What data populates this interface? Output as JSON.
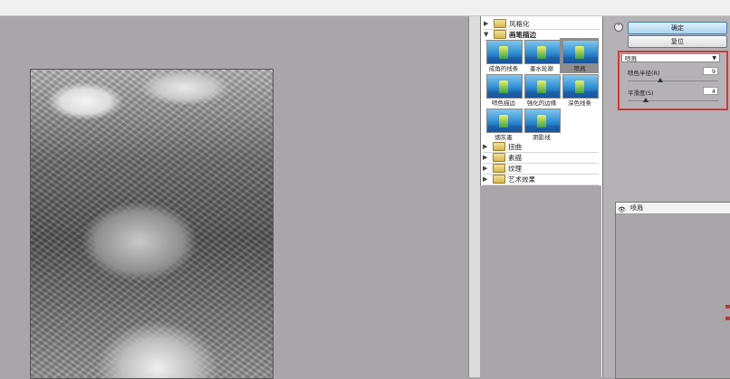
{
  "gallery": {
    "folders_top": [
      {
        "label": "风格化",
        "expanded": false
      },
      {
        "label": "画笔描边",
        "expanded": true
      }
    ],
    "items": [
      {
        "label": "成角的线条"
      },
      {
        "label": "墨水轮廓"
      },
      {
        "label": "喷溅"
      },
      {
        "label": "喷色描边"
      },
      {
        "label": "强化的边缘"
      },
      {
        "label": "深色线条"
      },
      {
        "label": "烟灰墨"
      },
      {
        "label": "阴影线"
      }
    ],
    "selected_item": "喷溅",
    "folders_bottom": [
      {
        "label": "扭曲"
      },
      {
        "label": "素描"
      },
      {
        "label": "纹理"
      },
      {
        "label": "艺术效果"
      }
    ]
  },
  "buttons": {
    "ok": "确定",
    "reset": "复位"
  },
  "settings": {
    "filter_select": "喷溅",
    "params": [
      {
        "label": "喷色半径(R)",
        "value": "9",
        "fraction": 0.36
      },
      {
        "label": "平滑度(S)",
        "value": "4",
        "fraction": 0.2
      }
    ]
  },
  "layers": {
    "rows": [
      {
        "name": "喷溅"
      }
    ]
  }
}
